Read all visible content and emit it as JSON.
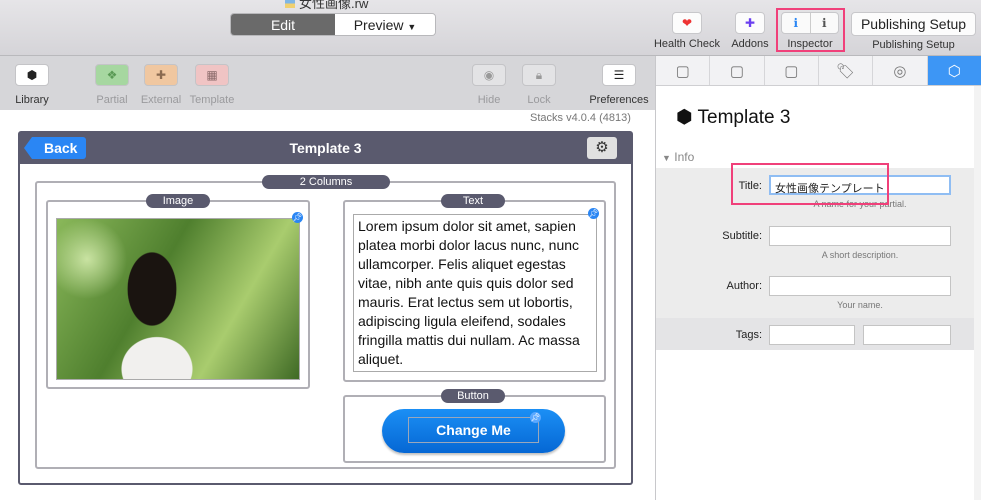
{
  "window": {
    "document_title": "女性画像.rw"
  },
  "topbar": {
    "edit_label": "Edit",
    "preview_label": "Preview",
    "health_check": "Health Check",
    "addons": "Addons",
    "inspector": "Inspector",
    "publishing_setup_button": "Publishing Setup",
    "publishing_setup_label": "Publishing Setup"
  },
  "toolbar": {
    "library": "Library",
    "partial": "Partial",
    "external": "External",
    "template": "Template",
    "hide": "Hide",
    "lock": "Lock",
    "preferences": "Preferences"
  },
  "version": "Stacks v4.0.4 (4813)",
  "editor": {
    "back": "Back",
    "title": "Template 3",
    "columns_label": "2 Columns",
    "image_label": "Image",
    "text_label": "Text",
    "button_label": "Button",
    "lorem": "Lorem ipsum dolor sit amet, sapien platea morbi dolor lacus nunc, nunc ullamcorper. Felis aliquet egestas vitae, nibh ante quis quis dolor sed mauris. Erat lectus sem ut lobortis, adipiscing ligula eleifend, sodales fringilla mattis dui nullam. Ac massa aliquet.",
    "cta": "Change Me"
  },
  "inspector": {
    "title": "Template 3",
    "section": "Info",
    "fields": {
      "title_label": "Title:",
      "title_value": "女性画像テンプレート",
      "title_hint": "A name for your partial.",
      "subtitle_label": "Subtitle:",
      "subtitle_value": "",
      "subtitle_hint": "A short description.",
      "author_label": "Author:",
      "author_value": "",
      "author_hint": "Your name.",
      "tags_label": "Tags:"
    }
  },
  "colors": {
    "accent": "#3d96f5",
    "header": "#5a5a6e",
    "highlight": "#f0407a"
  }
}
